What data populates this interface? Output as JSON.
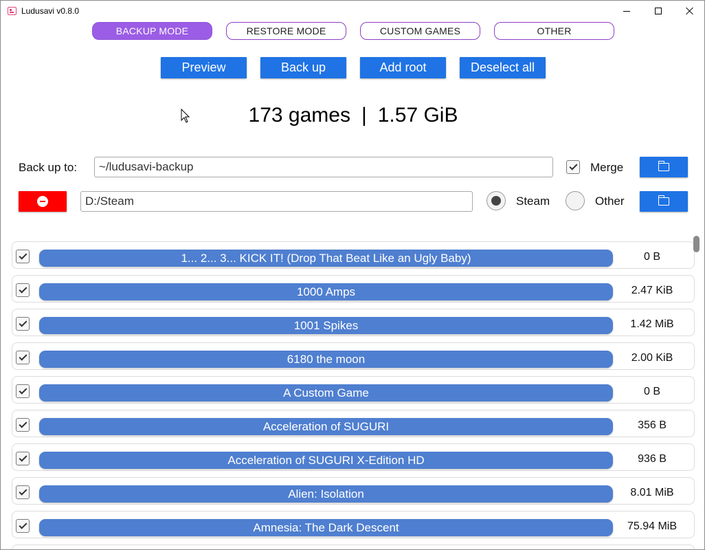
{
  "window": {
    "title": "Ludusavi v0.8.0"
  },
  "colors": {
    "accent_purple": "#9b5de5",
    "button_blue": "#1f73e5",
    "game_pill_blue": "#4f7fd0",
    "remove_red": "#ff0000"
  },
  "modes": [
    {
      "label": "BACKUP MODE",
      "active": true
    },
    {
      "label": "RESTORE MODE",
      "active": false
    },
    {
      "label": "CUSTOM GAMES",
      "active": false
    },
    {
      "label": "OTHER",
      "active": false
    }
  ],
  "actions": {
    "preview": "Preview",
    "back_up": "Back up",
    "add_root": "Add root",
    "deselect_all": "Deselect all"
  },
  "summary": {
    "games": "173 games",
    "separator": "|",
    "size": "1.57 GiB"
  },
  "backup_target": {
    "label": "Back up to:",
    "path": "~/ludusavi-backup",
    "merge_label": "Merge",
    "merge_checked": true
  },
  "root": {
    "path": "D:/Steam",
    "store_options": [
      {
        "label": "Steam",
        "selected": true
      },
      {
        "label": "Other",
        "selected": false
      }
    ]
  },
  "games": [
    {
      "name": "1... 2... 3... KICK IT! (Drop That Beat Like an Ugly Baby)",
      "size": "0 B",
      "checked": true
    },
    {
      "name": "1000 Amps",
      "size": "2.47 KiB",
      "checked": true
    },
    {
      "name": "1001 Spikes",
      "size": "1.42 MiB",
      "checked": true
    },
    {
      "name": "6180 the moon",
      "size": "2.00 KiB",
      "checked": true
    },
    {
      "name": "A Custom Game",
      "size": "0 B",
      "checked": true
    },
    {
      "name": "Acceleration of SUGURI",
      "size": "356 B",
      "checked": true
    },
    {
      "name": "Acceleration of SUGURI X-Edition HD",
      "size": "936 B",
      "checked": true
    },
    {
      "name": "Alien: Isolation",
      "size": "8.01 MiB",
      "checked": true
    },
    {
      "name": "Amnesia: The Dark Descent",
      "size": "75.94 MiB",
      "checked": true
    }
  ]
}
